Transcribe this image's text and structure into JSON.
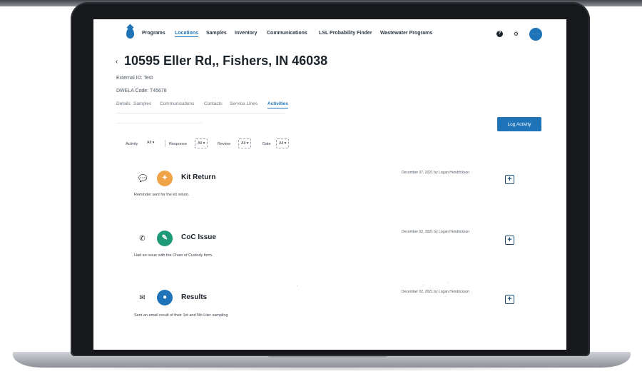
{
  "nav": {
    "links": [
      "Programs",
      "Locations",
      "Samples",
      "Inventory",
      "Communications",
      "LSL Probability Finder",
      "Wastewater Programs"
    ],
    "active_link": "Locations",
    "help_glyph": "?",
    "settings_glyph": "⚙",
    "avatar_initials": "· · ·"
  },
  "header": {
    "back_glyph": "‹",
    "title": "10595 Eller Rd,, Fishers, IN 46038",
    "external_id": "External ID: Test",
    "dwela_code": "DWELA Code: T45678"
  },
  "tabs": {
    "labels": [
      "Details",
      "Samples",
      "Communications",
      "Contacts",
      "Service Lines",
      "Activities"
    ],
    "active": "Activities"
  },
  "actions": {
    "log_activity": "Log Activity"
  },
  "filters": {
    "activity_label": "Activity",
    "activity_value": "All ▾",
    "response_label": "Response",
    "response_value": "All ▾",
    "review_label": "Review",
    "review_value": "All ▾",
    "date_label": "Date",
    "date_value": "All ▾"
  },
  "activities": [
    {
      "type_icon": "chat-icon",
      "type_glyph": "💬",
      "badge_glyph": "✦",
      "badge_color": "#f0a447",
      "title": "Kit Return",
      "date_line": "December 07, 2021 by Logan Hendrickson",
      "description": "Reminder sent for the kit return.",
      "expand_glyph": "+"
    },
    {
      "type_icon": "phone-icon",
      "type_glyph": "✆",
      "badge_glyph": "✎",
      "badge_color": "#1f9a78",
      "title": "CoC Issue",
      "date_line": "December 02, 2021 by Logan Hendrickson",
      "description": "Had an issue with the Chain of Custody form.",
      "expand_glyph": "+"
    },
    {
      "type_icon": "mail-icon",
      "type_glyph": "✉",
      "badge_glyph": "●",
      "badge_color": "#1f74b9",
      "title": "Results",
      "date_line": "December 02, 2021 by Logan Hendrickson",
      "description": "Sent an email result of their 1st and 5th Liter sampling",
      "expand_glyph": "+"
    }
  ],
  "colors": {
    "accent": "#1f74b9",
    "text": "#1b232b",
    "laptop_frame": "#16181b"
  }
}
